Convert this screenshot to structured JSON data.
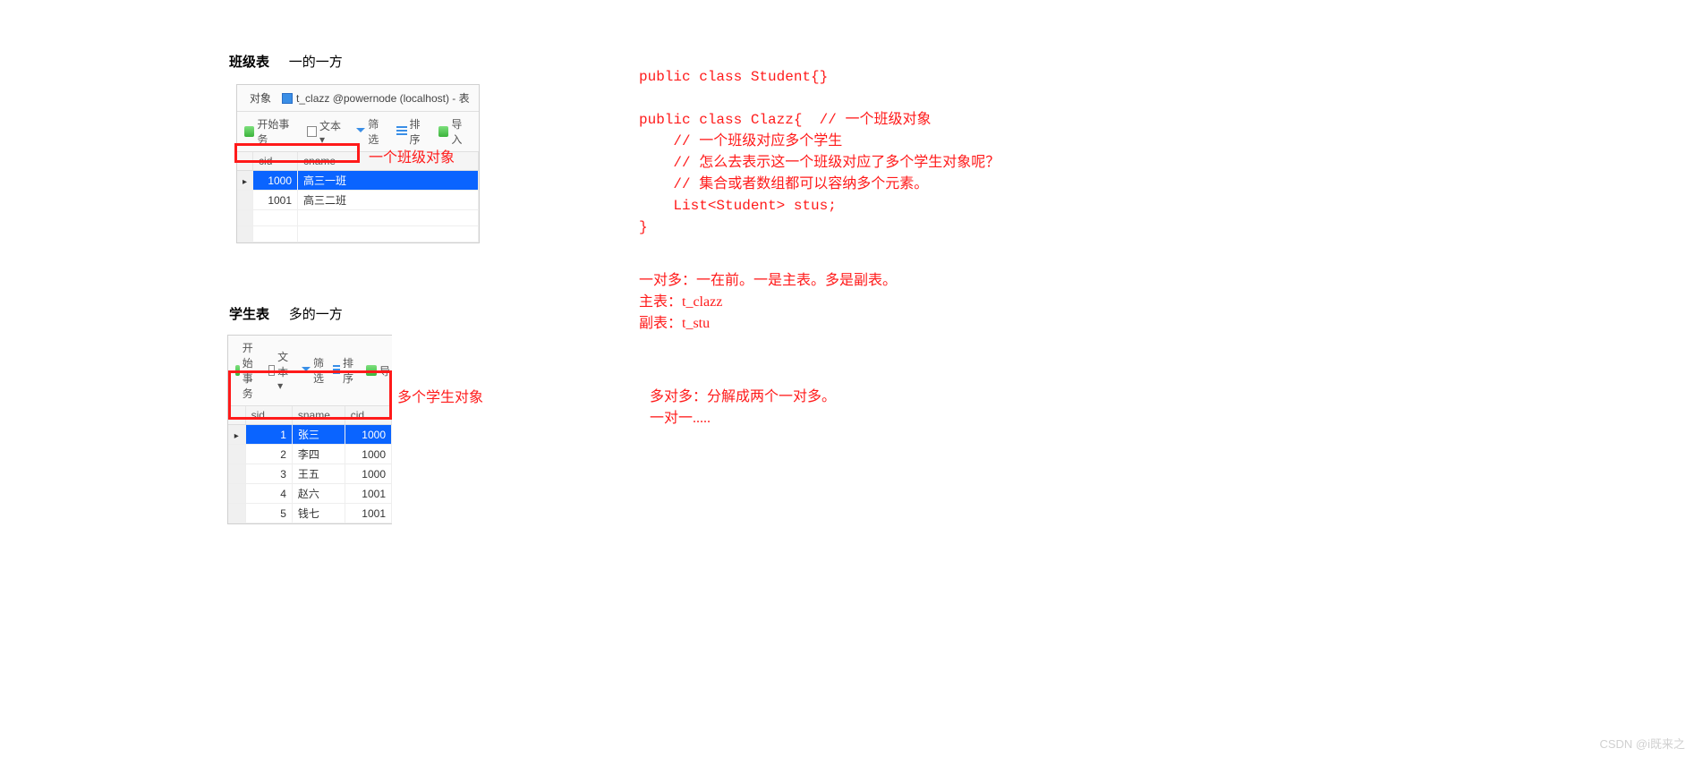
{
  "clazz_section": {
    "title": "班级表",
    "subtitle": "一的一方",
    "tab_objects": "对象",
    "tab_title": "t_clazz @powernode (localhost) - 表",
    "toolbar": {
      "start": "开始事务",
      "text": "文本 ▾",
      "filter": "筛选",
      "sort": "排序",
      "import": "导入"
    },
    "headers": {
      "cid": "cid",
      "cname": "cname"
    },
    "rows": [
      {
        "cid": "1000",
        "cname": "高三一班"
      },
      {
        "cid": "1001",
        "cname": "高三二班"
      }
    ],
    "label": "一个班级对象"
  },
  "stu_section": {
    "title": "学生表",
    "subtitle": "多的一方",
    "toolbar": {
      "start": "开始事务",
      "text": "文本 ▾",
      "filter": "筛选",
      "sort": "排序",
      "import": "导"
    },
    "headers": {
      "sid": "sid",
      "sname": "sname",
      "cid": "cid"
    },
    "rows": [
      {
        "sid": "1",
        "sname": "张三",
        "cid": "1000"
      },
      {
        "sid": "2",
        "sname": "李四",
        "cid": "1000"
      },
      {
        "sid": "3",
        "sname": "王五",
        "cid": "1000"
      },
      {
        "sid": "4",
        "sname": "赵六",
        "cid": "1001"
      },
      {
        "sid": "5",
        "sname": "钱七",
        "cid": "1001"
      }
    ],
    "label": "多个学生对象"
  },
  "code": {
    "l1": "public class Student{}",
    "l2": "public class Clazz{  // 一个班级对象",
    "l3": "    // 一个班级对应多个学生",
    "l4": "    // 怎么去表示这一个班级对应了多个学生对象呢？",
    "l5": "    // 集合或者数组都可以容纳多个元素。",
    "l6": "    List<Student> stus;",
    "l7": "}"
  },
  "note1": {
    "l1": "一对多：一在前。一是主表。多是副表。",
    "l2": "主表：t_clazz",
    "l3": "副表：t_stu"
  },
  "note2": {
    "l1": "多对多：分解成两个一对多。",
    "l2": "一对一....."
  },
  "watermark": "CSDN @i既来之"
}
